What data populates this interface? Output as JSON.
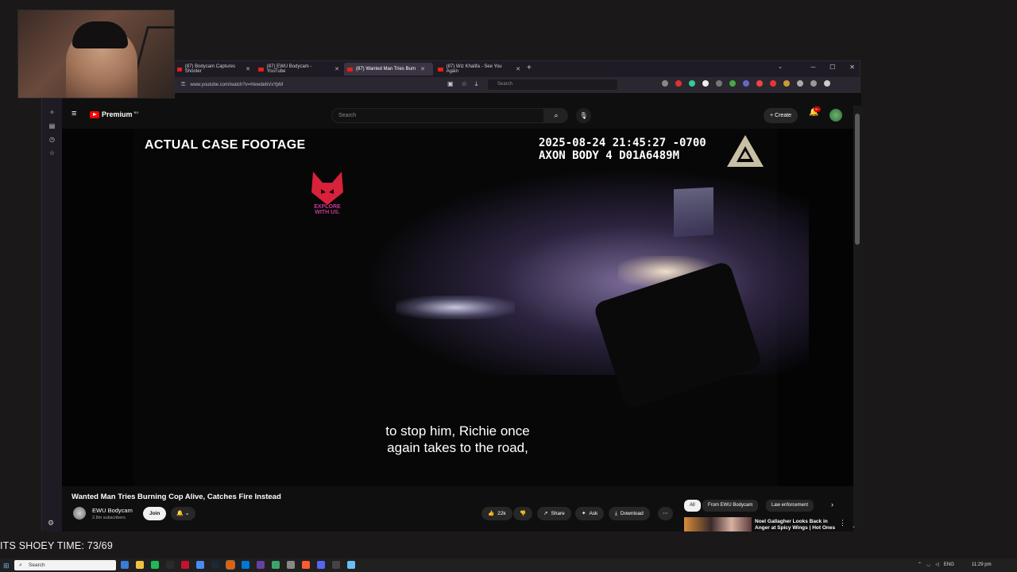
{
  "browser": {
    "tabs": [
      {
        "label": "(87) Bodycam Captures Shooter",
        "active": false
      },
      {
        "label": "(87) EWU Bodycam - YouTube",
        "active": false
      },
      {
        "label": "(87) Wanted Man Tries Burn",
        "active": true
      },
      {
        "label": "(87) Wiz Khalifa - See You Again",
        "active": false
      }
    ],
    "url": "www.youtube.com/watch?v=HewdebVxYpM",
    "search_placeholder": "Search"
  },
  "youtube": {
    "logo_text": "Premium",
    "logo_sup": "BG",
    "search_placeholder": "Search",
    "create_label": "Create",
    "notification_count": "9+"
  },
  "video": {
    "footage_label": "ACTUAL CASE FOOTAGE",
    "timestamp_line1": "2025-08-24 21:45:27 -0700",
    "timestamp_line2": "AXON BODY 4 D01A6489M",
    "explore_line1": "EXPLORE",
    "explore_line2": "WITH US.",
    "subtitle_line1": "to stop him, Richie once",
    "subtitle_line2": "again takes to the road,"
  },
  "details": {
    "title": "Wanted Man Tries Burning Cop Alive, Catches Fire Instead",
    "channel_name": "EWU Bodycam",
    "channel_subs": "2.8m subscribers",
    "join_label": "Join",
    "like_count": "22k",
    "share_label": "Share",
    "ask_label": "Ask",
    "download_label": "Download"
  },
  "chips": [
    {
      "label": "All",
      "active": true
    },
    {
      "label": "From EWU Bodycam",
      "active": false
    },
    {
      "label": "Law enforcement",
      "active": false
    }
  ],
  "recommendation": {
    "title": "Noel Gallagher Looks Back in Anger at Spicy Wings | Hot Ones"
  },
  "overlay": {
    "shoey_text": "ITS SHOEY TIME: 73/69"
  },
  "taskbar": {
    "search_placeholder": "Search",
    "language": "ENG",
    "clock": "11:29 pm"
  },
  "colors": {
    "youtube_red": "#ff0000",
    "background": "#0f0f0f",
    "accent_tab": "#3b3443"
  }
}
